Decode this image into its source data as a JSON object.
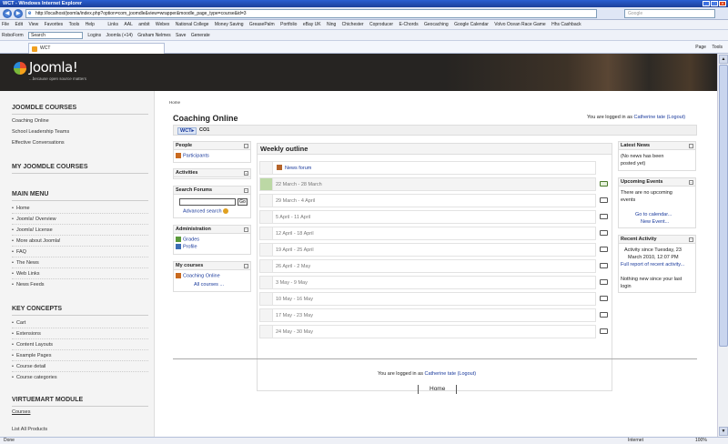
{
  "browser": {
    "title": "WCT - Windows Internet Explorer",
    "url": "http://localhost/joomla/index.php?option=com_joomdle&view=wrapper&moodle_page_type=course&id=3",
    "search_placeholder": "Google",
    "menu": [
      "File",
      "Edit",
      "View",
      "Favorites",
      "Tools",
      "Help"
    ],
    "links": [
      "Links",
      "AAL",
      "ambit",
      "Webex",
      "National College",
      "Money Saving",
      "GreasePalm",
      "Portfolio",
      "eBay UK",
      "Ning",
      "Chichester",
      "Coproducer",
      "E-Chords",
      "Geocaching",
      "Google Calendar",
      "Volvo Ocean Race Game",
      "Hhs Cashback"
    ],
    "toolbar": [
      "RoboForm",
      "Search",
      "Logins",
      "Joomla (+14)",
      "Graham Nelmes",
      "Save",
      "Generate"
    ],
    "tab_title": "WCT",
    "tab_tools": [
      "Page",
      "Tools"
    ],
    "status_left": "Done",
    "status_zone": "Internet",
    "status_zoom": "100%"
  },
  "header": {
    "logo_name": "Joomla!",
    "logo_tagline": "...because open source matters"
  },
  "sidebar": {
    "joomdle_courses": {
      "title": "JOOMDLE COURSES",
      "items": [
        "Coaching Online",
        "School Leadership Teams",
        "Effective Conversations"
      ]
    },
    "my_joomdle_courses": {
      "title": "MY JOOMDLE COURSES"
    },
    "main_menu": {
      "title": "MAIN MENU",
      "items": [
        "Home",
        "Joomla! Overview",
        "Joomla! License",
        "More about Joomla!",
        "FAQ",
        "The News",
        "Web Links",
        "News Feeds"
      ]
    },
    "key_concepts": {
      "title": "KEY CONCEPTS",
      "items": [
        "Cart",
        "Extensions",
        "Content Layouts",
        "Example Pages",
        "Course detail",
        "Course categories"
      ]
    },
    "virtuemart": {
      "title": "VIRTUEMART MODULE",
      "items": [
        "Courses",
        "List All Products"
      ]
    }
  },
  "main": {
    "breadcrumb": "Home",
    "course_title": "Coaching Online",
    "logged_in_prefix": "You are logged in as",
    "user_name": "Catherine tate",
    "logout": "(Logout)",
    "nav_wct": "WCT▸",
    "nav_co1": "CO1",
    "home_link": "Home"
  },
  "blocks": {
    "people": {
      "title": "People",
      "participants": "Participants"
    },
    "activities": {
      "title": "Activities"
    },
    "search_forums": {
      "title": "Search Forums",
      "go": "Go",
      "advanced": "Advanced search"
    },
    "administration": {
      "title": "Administration",
      "grades": "Grades",
      "profile": "Profile"
    },
    "my_courses": {
      "title": "My courses",
      "course": "Coaching Online",
      "all": "All courses ..."
    },
    "latest_news": {
      "title": "Latest News",
      "text1": "(No news has been",
      "text2": "posted yet)"
    },
    "upcoming": {
      "title": "Upcoming Events",
      "text1": "There are no upcoming",
      "text2": "events",
      "calendar": "Go to calendar...",
      "new_event": "New Event..."
    },
    "recent": {
      "title": "Recent Activity",
      "line1": "Activity since Tuesday, 23",
      "line2": "March 2010, 12:07 PM",
      "full": "Full report of recent activity...",
      "none1": "Nothing new since your last",
      "none2": "login"
    }
  },
  "weekly": {
    "title": "Weekly outline",
    "forum": "News forum",
    "weeks": [
      "22 March - 28 March",
      "29 March - 4 April",
      "5 April - 11 April",
      "12 April - 18 April",
      "19 April - 25 April",
      "26 April - 2 May",
      "3 May - 9 May",
      "10 May - 16 May",
      "17 May - 23 May",
      "24 May - 30 May"
    ],
    "current_week_index": 0
  }
}
